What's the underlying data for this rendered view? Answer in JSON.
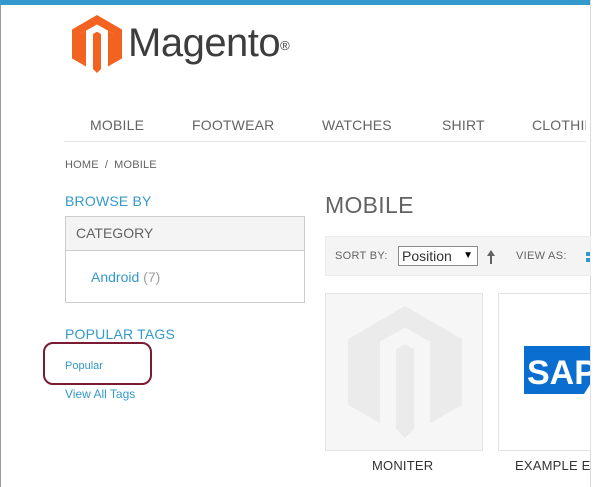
{
  "brand": {
    "name": "Magento",
    "trademark": "®",
    "colors": {
      "orange": "#f26322",
      "accent": "#3399cc"
    }
  },
  "nav": {
    "items": [
      "MOBILE",
      "FOOTWEAR",
      "WATCHES",
      "SHIRT",
      "CLOTHIN"
    ]
  },
  "breadcrumb": {
    "home": "HOME",
    "separator": "/",
    "current": "MOBILE"
  },
  "sidebar": {
    "browse_title": "BROWSE BY",
    "filter_heading": "CATEGORY",
    "filter_option": {
      "label": "Android",
      "count": "(7)"
    },
    "tags_title": "POPULAR TAGS",
    "tag": "Popular",
    "view_all": "View All Tags",
    "annotation_color": "#7a1a33"
  },
  "main": {
    "title": "MOBILE",
    "toolbar": {
      "sort_label": "SORT BY:",
      "sort_value": "Position",
      "view_label": "VIEW AS:"
    },
    "products": [
      {
        "name": "MONITER",
        "image": "magento-placeholder-icon"
      },
      {
        "name": "EXAMPLE E",
        "image": "sap-logo"
      }
    ]
  }
}
